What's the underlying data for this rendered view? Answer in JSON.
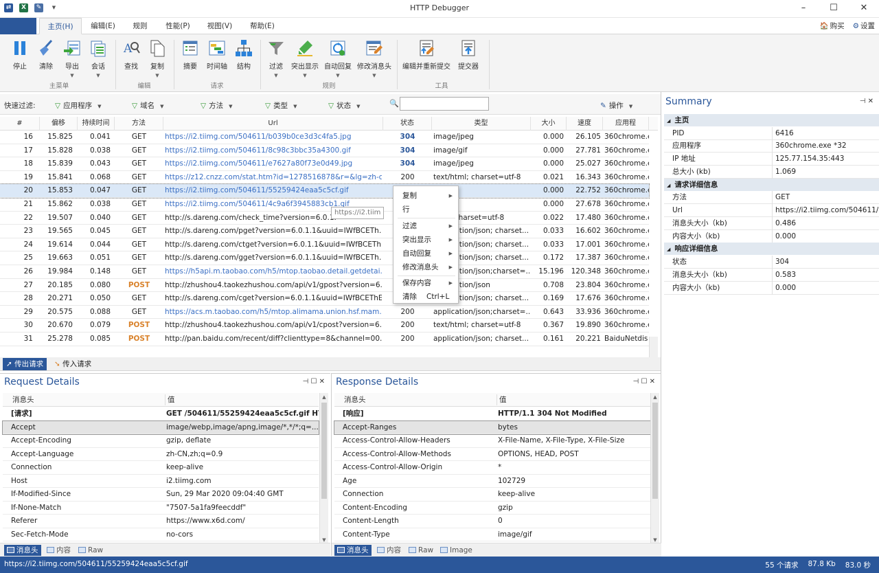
{
  "window": {
    "title": "HTTP Debugger",
    "minimize": "–",
    "maximize": "☐",
    "close": "✕"
  },
  "menu": {
    "tabs": [
      "主页(H)",
      "编辑(E)",
      "规则",
      "性能(P)",
      "视图(V)",
      "帮助(E)"
    ],
    "active_index": 0,
    "buy": "购买",
    "settings": "设置"
  },
  "ribbon": {
    "buttons": [
      {
        "label": "停止",
        "icon": "pause-icon"
      },
      {
        "label": "清除",
        "icon": "broom-icon"
      },
      {
        "label": "导出",
        "icon": "export-icon"
      },
      {
        "label": "会话",
        "icon": "session-icon"
      },
      {
        "label": "查找",
        "icon": "find-icon"
      },
      {
        "label": "复制",
        "icon": "copy-icon"
      },
      {
        "label": "摘要",
        "icon": "summary-icon"
      },
      {
        "label": "时间轴",
        "icon": "timeline-icon"
      },
      {
        "label": "结构",
        "icon": "structure-icon"
      },
      {
        "label": "过滤",
        "icon": "filter-icon"
      },
      {
        "label": "突出显示",
        "icon": "highlight-icon"
      },
      {
        "label": "自动回复",
        "icon": "auto-reply-icon"
      },
      {
        "label": "修改消息头",
        "icon": "modify-header-icon"
      },
      {
        "label": "编辑并重新提交",
        "icon": "edit-resubmit-icon"
      },
      {
        "label": "提交器",
        "icon": "submitter-icon"
      }
    ],
    "groups": [
      "主菜单",
      "编辑",
      "请求",
      "规则",
      "工具"
    ]
  },
  "filters": {
    "label": "快速过滤:",
    "items": [
      "应用程序",
      "域名",
      "方法",
      "类型",
      "状态"
    ],
    "search_value": "",
    "actions": "操作"
  },
  "grid": {
    "columns": [
      "#",
      "偏移",
      "持续时间",
      "方法",
      "Url",
      "状态",
      "类型",
      "大小",
      "速度",
      "应用程"
    ],
    "rows": [
      {
        "n": "16",
        "offset": "15.825",
        "dur": "0.041",
        "method": "GET",
        "url": "https://i2.tiimg.com/504611/b039b0ce3d3c4fa5.jpg",
        "status": "304",
        "type": "image/jpeg",
        "size": "0.000",
        "speed": "26.105",
        "app": "360chrome.e",
        "blue": true
      },
      {
        "n": "17",
        "offset": "15.828",
        "dur": "0.038",
        "method": "GET",
        "url": "https://i2.tiimg.com/504611/8c98c3bbc35a4300.gif",
        "status": "304",
        "type": "image/gif",
        "size": "0.000",
        "speed": "27.781",
        "app": "360chrome.e",
        "blue": true
      },
      {
        "n": "18",
        "offset": "15.839",
        "dur": "0.043",
        "method": "GET",
        "url": "https://i2.tiimg.com/504611/e7627a80f73e0d49.jpg",
        "status": "304",
        "type": "image/jpeg",
        "size": "0.000",
        "speed": "25.027",
        "app": "360chrome.e",
        "blue": true
      },
      {
        "n": "19",
        "offset": "15.841",
        "dur": "0.068",
        "method": "GET",
        "url": "https://z12.cnzz.com/stat.htm?id=1278516878&r=&lg=zh-c...",
        "status": "200",
        "type": "text/html; charset=utf-8",
        "size": "0.021",
        "speed": "16.343",
        "app": "360chrome.e",
        "blue": true
      },
      {
        "n": "20",
        "offset": "15.853",
        "dur": "0.047",
        "method": "GET",
        "url": "https://i2.tiimg.com/504611/55259424eaa5c5cf.gif",
        "status": "",
        "type": "gif",
        "size": "0.000",
        "speed": "22.752",
        "app": "360chrome.e",
        "blue": true,
        "selected": true
      },
      {
        "n": "21",
        "offset": "15.862",
        "dur": "0.038",
        "method": "GET",
        "url": "https://i2.tiimg.com/504611/4c9a6f3945883cb1.gif",
        "status": "",
        "type": "gif",
        "size": "0.000",
        "speed": "27.678",
        "app": "360chrome.e",
        "blue": true
      },
      {
        "n": "22",
        "offset": "19.507",
        "dur": "0.040",
        "method": "GET",
        "url": "http://s.dareng.com/check_time?version=6.0.1.",
        "status": "",
        "type": "html; charset=utf-8",
        "size": "0.022",
        "speed": "17.480",
        "app": "360chrome.e"
      },
      {
        "n": "23",
        "offset": "19.565",
        "dur": "0.045",
        "method": "GET",
        "url": "http://s.dareng.com/pget?version=6.0.1.1&uuid=IWfBCETh...",
        "status": "",
        "type": "application/json; charset...",
        "size": "0.033",
        "speed": "16.602",
        "app": "360chrome.e"
      },
      {
        "n": "24",
        "offset": "19.614",
        "dur": "0.044",
        "method": "GET",
        "url": "http://s.dareng.com/ctget?version=6.0.1.1&uuid=IWfBCETh...",
        "status": "",
        "type": "application/json; charset...",
        "size": "0.033",
        "speed": "17.001",
        "app": "360chrome.e"
      },
      {
        "n": "25",
        "offset": "19.663",
        "dur": "0.051",
        "method": "GET",
        "url": "http://s.dareng.com/gget?version=6.0.1.1&uuid=IWfBCETh...",
        "status": "",
        "type": "application/json; charset...",
        "size": "0.172",
        "speed": "17.387",
        "app": "360chrome.e"
      },
      {
        "n": "26",
        "offset": "19.984",
        "dur": "0.148",
        "method": "GET",
        "url": "https://h5api.m.taobao.com/h5/mtop.taobao.detail.getdetai...",
        "status": "",
        "type": "application/json;charset=...",
        "size": "15.196",
        "speed": "120.348",
        "app": "360chrome.e",
        "blue": true
      },
      {
        "n": "27",
        "offset": "20.185",
        "dur": "0.080",
        "method": "POST",
        "url": "http://zhushou4.taokezhushou.com/api/v1/gpost?version=6...",
        "status": "",
        "type": "application/json",
        "size": "0.708",
        "speed": "23.804",
        "app": "360chrome.e"
      },
      {
        "n": "28",
        "offset": "20.271",
        "dur": "0.050",
        "method": "GET",
        "url": "http://s.dareng.com/cget?version=6.0.1.1&uuid=IWfBCEThE...",
        "status": "",
        "type": "application/json; charset...",
        "size": "0.169",
        "speed": "17.676",
        "app": "360chrome.e"
      },
      {
        "n": "29",
        "offset": "20.575",
        "dur": "0.088",
        "method": "GET",
        "url": "https://acs.m.taobao.com/h5/mtop.alimama.union.hsf.mam...",
        "status": "200",
        "type": "application/json;charset=...",
        "size": "0.643",
        "speed": "33.936",
        "app": "360chrome.e",
        "blue": true
      },
      {
        "n": "30",
        "offset": "20.670",
        "dur": "0.079",
        "method": "POST",
        "url": "http://zhushou4.taokezhushou.com/api/v1/cpost?version=6...",
        "status": "200",
        "type": "text/html; charset=utf-8",
        "size": "0.367",
        "speed": "19.890",
        "app": "360chrome.e"
      },
      {
        "n": "31",
        "offset": "25.278",
        "dur": "0.085",
        "method": "POST",
        "url": "http://pan.baidu.com/recent/diff?clienttype=8&channel=00...",
        "status": "200",
        "type": "application/json; charset...",
        "size": "0.161",
        "speed": "20.221",
        "app": "BaiduNetdis"
      }
    ]
  },
  "tooltip": "https://i2.tiim",
  "tooltip_tail": "24eaa5c5cf.gif",
  "context_menu": {
    "items": [
      {
        "label": "复制",
        "submenu": true
      },
      {
        "label": "行",
        "submenu": false
      },
      {
        "label": "过滤",
        "submenu": true
      },
      {
        "label": "突出显示",
        "submenu": true
      },
      {
        "label": "自动回复",
        "submenu": true
      },
      {
        "label": "修改消息头",
        "submenu": true
      },
      {
        "label": "保存内容",
        "submenu": true
      },
      {
        "label": "清除",
        "submenu": false,
        "shortcut": "Ctrl+L"
      }
    ]
  },
  "direction_tabs": [
    "传出请求",
    "传入请求"
  ],
  "summary": {
    "title": "Summary",
    "sections": [
      {
        "title": "主页",
        "rows": [
          [
            "PID",
            "6416"
          ],
          [
            "应用程序",
            "360chrome.exe *32"
          ],
          [
            "IP 地址",
            "125.77.154.35:443"
          ],
          [
            "总大小 (kb)",
            "1.069"
          ]
        ]
      },
      {
        "title": "请求详细信息",
        "rows": [
          [
            "方法",
            "GET"
          ],
          [
            "Url",
            "https://i2.tiimg.com/504611/5"
          ],
          [
            "消息头大小（kb)",
            "0.486"
          ],
          [
            "内容大小（kb)",
            "0.000"
          ]
        ]
      },
      {
        "title": "响应详细信息",
        "rows": [
          [
            "状态",
            "304"
          ],
          [
            "消息头大小（kb)",
            "0.583"
          ],
          [
            "内容大小（kb)",
            "0.000"
          ]
        ]
      }
    ]
  },
  "request_details": {
    "title": "Request Details",
    "col_key": "消息头",
    "col_val": "值",
    "rows": [
      [
        "[请求]",
        "GET /504611/55259424eaa5c5cf.gif HT..."
      ],
      [
        "Accept",
        "image/webp,image/apng,image/*,*/*;q=..."
      ],
      [
        "Accept-Encoding",
        "gzip, deflate"
      ],
      [
        "Accept-Language",
        "zh-CN,zh;q=0.9"
      ],
      [
        "Connection",
        "keep-alive"
      ],
      [
        "Host",
        "i2.tiimg.com"
      ],
      [
        "If-Modified-Since",
        "Sun, 29 Mar 2020 09:04:40 GMT"
      ],
      [
        "If-None-Match",
        "\"7507-5a1fa9feecddf\""
      ],
      [
        "Referer",
        "https://www.x6d.com/"
      ],
      [
        "Sec-Fetch-Mode",
        "no-cors"
      ]
    ],
    "tabs": [
      "消息头",
      "内容",
      "Raw"
    ]
  },
  "response_details": {
    "title": "Response Details",
    "col_key": "消息头",
    "col_val": "值",
    "rows": [
      [
        "[响应]",
        "HTTP/1.1 304 Not Modified"
      ],
      [
        "Accept-Ranges",
        "bytes"
      ],
      [
        "Access-Control-Allow-Headers",
        "X-File-Name, X-File-Type, X-File-Size"
      ],
      [
        "Access-Control-Allow-Methods",
        "OPTIONS, HEAD, POST"
      ],
      [
        "Access-Control-Allow-Origin",
        "*"
      ],
      [
        "Age",
        "102729"
      ],
      [
        "Connection",
        "keep-alive"
      ],
      [
        "Content-Encoding",
        "gzip"
      ],
      [
        "Content-Length",
        "0"
      ],
      [
        "Content-Type",
        "image/gif"
      ]
    ],
    "tabs": [
      "消息头",
      "内容",
      "Raw",
      "Image"
    ]
  },
  "statusbar": {
    "url": "https://i2.tiimg.com/504611/55259424eaa5c5cf.gif",
    "requests": "55 个请求",
    "size": "87.8 Kb",
    "time": "83.0 秒"
  },
  "colors": {
    "accent": "#2b579a",
    "link": "#3a6fc4",
    "post": "#d9822b"
  }
}
